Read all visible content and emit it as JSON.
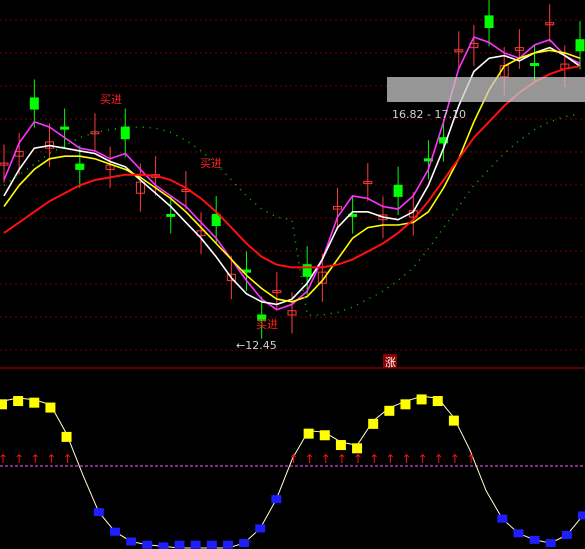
{
  "colors": {
    "background": "#000000",
    "grid": "#7a0000",
    "divider": "#c00000",
    "up_candle": "#ff3b3b",
    "down_candle": "#00ff00",
    "cyan_block": "#00e5ff",
    "white_line": "#ffffff",
    "yellow_line": "#ffff00",
    "magenta_line": "#ff33ff",
    "red_line": "#ff1010",
    "dotted_line": "#00cc00",
    "label": "#ff2020",
    "low_label": "#d0d0d0",
    "range_label": "#d0d0d0",
    "oscillator_line": "#ffffcc",
    "osc_high": "#ffff00",
    "osc_low": "#1e1eff",
    "baseline": "#ff55ff",
    "arrow": "#ff1010"
  },
  "labels": {
    "buy_signals": [
      "买进",
      "买进",
      "买进"
    ],
    "low_marker": "←12.45",
    "range_box_text": "16.82 - 17.10",
    "rise_badge": "涨"
  },
  "chart_data": [
    {
      "type": "line",
      "series": [
        {
          "values": [
            15.2,
            15.9,
            16.3,
            16.2,
            16.0,
            15.8,
            15.75,
            15.6,
            15.7,
            15.4,
            15.1,
            14.9,
            14.7,
            14.4,
            14.1,
            13.7,
            13.3,
            12.95,
            12.75,
            12.85,
            13.1,
            13.7,
            14.5,
            14.9,
            14.85,
            14.7,
            14.65,
            14.9,
            15.4,
            16.3,
            17.3,
            17.9,
            17.8,
            17.6,
            17.5,
            17.75,
            17.85,
            17.55,
            17.4
          ]
        },
        {
          "values": [
            14.9,
            15.4,
            15.8,
            15.85,
            15.8,
            15.75,
            15.7,
            15.55,
            15.45,
            15.2,
            14.95,
            14.7,
            14.4,
            14.1,
            13.75,
            13.35,
            13.05,
            12.9,
            12.85,
            12.95,
            13.25,
            13.7,
            14.3,
            14.6,
            14.6,
            14.5,
            14.45,
            14.6,
            15.1,
            15.8,
            16.6,
            17.25,
            17.5,
            17.55,
            17.45,
            17.6,
            17.7,
            17.55,
            17.35
          ]
        },
        {
          "values": [
            14.7,
            15.1,
            15.4,
            15.6,
            15.65,
            15.65,
            15.6,
            15.5,
            15.4,
            15.25,
            15.05,
            14.85,
            14.6,
            14.3,
            14.0,
            13.7,
            13.4,
            13.15,
            12.95,
            12.9,
            13.0,
            13.3,
            13.7,
            14.1,
            14.3,
            14.35,
            14.35,
            14.4,
            14.6,
            15.05,
            15.6,
            16.3,
            16.9,
            17.35,
            17.5,
            17.6,
            17.65,
            17.6,
            17.5
          ]
        },
        {
          "values": [
            14.2,
            14.4,
            14.6,
            14.8,
            14.95,
            15.1,
            15.2,
            15.25,
            15.3,
            15.3,
            15.28,
            15.2,
            15.05,
            14.85,
            14.6,
            14.3,
            14.0,
            13.75,
            13.6,
            13.55,
            13.55,
            13.55,
            13.6,
            13.7,
            13.85,
            14.0,
            14.2,
            14.45,
            14.8,
            15.2,
            15.6,
            16.0,
            16.3,
            16.6,
            16.85,
            17.05,
            17.2,
            17.3,
            17.35
          ]
        }
      ]
    },
    {
      "type": "line",
      "ylim": [
        0,
        100
      ],
      "values": [
        90,
        92,
        91,
        88,
        70,
        45,
        22,
        10,
        4,
        2,
        1,
        0,
        0,
        0,
        0,
        3,
        12,
        30,
        55,
        72,
        71,
        65,
        63,
        78,
        86,
        90,
        93,
        92,
        80,
        60,
        35,
        18,
        9,
        5,
        3,
        8,
        20
      ]
    }
  ]
}
